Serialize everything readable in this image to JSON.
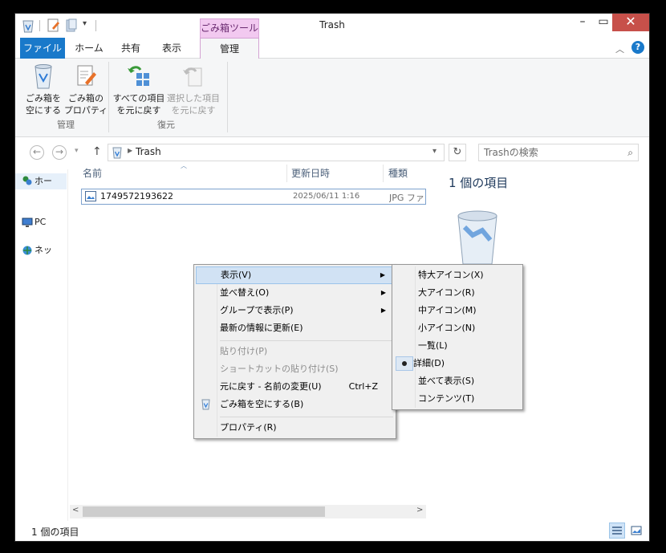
{
  "window": {
    "title": "Trash",
    "context_tab_header": "ごみ箱ツール"
  },
  "tabs": [
    "ファイル",
    "ホーム",
    "共有",
    "表示",
    "管理"
  ],
  "ribbon": {
    "groups": [
      {
        "label": "管理",
        "buttons": [
          {
            "line1": "ごみ箱を",
            "line2": "空にする",
            "enabled": true,
            "icon": "recycle-bin-icon"
          },
          {
            "line1": "ごみ箱の",
            "line2": "プロパティ",
            "enabled": true,
            "icon": "properties-icon"
          }
        ]
      },
      {
        "label": "復元",
        "buttons": [
          {
            "line1": "すべての項目",
            "line2": "を元に戻す",
            "enabled": true,
            "icon": "restore-all-icon"
          },
          {
            "line1": "選択した項目",
            "line2": "を元に戻す",
            "enabled": false,
            "icon": "restore-selected-icon"
          }
        ]
      }
    ]
  },
  "address": {
    "path": "Trash",
    "search_placeholder": "Trashの検索"
  },
  "navpane": {
    "items": [
      {
        "label": "ホー",
        "icon": "homegroup-icon"
      },
      {
        "label": "PC",
        "icon": "pc-icon"
      },
      {
        "label": "ネッ",
        "icon": "network-icon"
      }
    ]
  },
  "filelist": {
    "columns": [
      "名前",
      "更新日時",
      "種類"
    ],
    "rows": [
      {
        "name": "1749572193622",
        "modified": "2025/06/11 1:16",
        "type": "JPG ファ"
      }
    ]
  },
  "preview": {
    "title": "1 個の項目"
  },
  "status": {
    "text": "1 個の項目"
  },
  "context_menu": {
    "items": [
      {
        "label": "表示(V)",
        "submenu": true,
        "highlighted": true
      },
      {
        "label": "並べ替え(O)",
        "submenu": true
      },
      {
        "label": "グループで表示(P)",
        "submenu": true
      },
      {
        "label": "最新の情報に更新(E)"
      },
      {
        "label": "貼り付け(P)",
        "disabled": true
      },
      {
        "label": "ショートカットの貼り付け(S)",
        "disabled": true
      },
      {
        "label": "元に戻す - 名前の変更(U)",
        "shortcut": "Ctrl+Z"
      },
      {
        "label": "ごみ箱を空にする(B)",
        "icon": "recycle-bin-icon"
      },
      {
        "label": "プロパティ(R)"
      }
    ]
  },
  "view_submenu": {
    "items": [
      {
        "label": "特大アイコン(X)"
      },
      {
        "label": "大アイコン(R)"
      },
      {
        "label": "中アイコン(M)"
      },
      {
        "label": "小アイコン(N)"
      },
      {
        "label": "一覧(L)"
      },
      {
        "label": "詳細(D)",
        "selected": true
      },
      {
        "label": "並べて表示(S)"
      },
      {
        "label": "コンテンツ(T)"
      }
    ]
  },
  "colors": {
    "file_tab": "#1979ca",
    "context_tab": "#f2c9f0",
    "menu_highlight": "#d1e2f4",
    "close_button": "#c7504a"
  }
}
